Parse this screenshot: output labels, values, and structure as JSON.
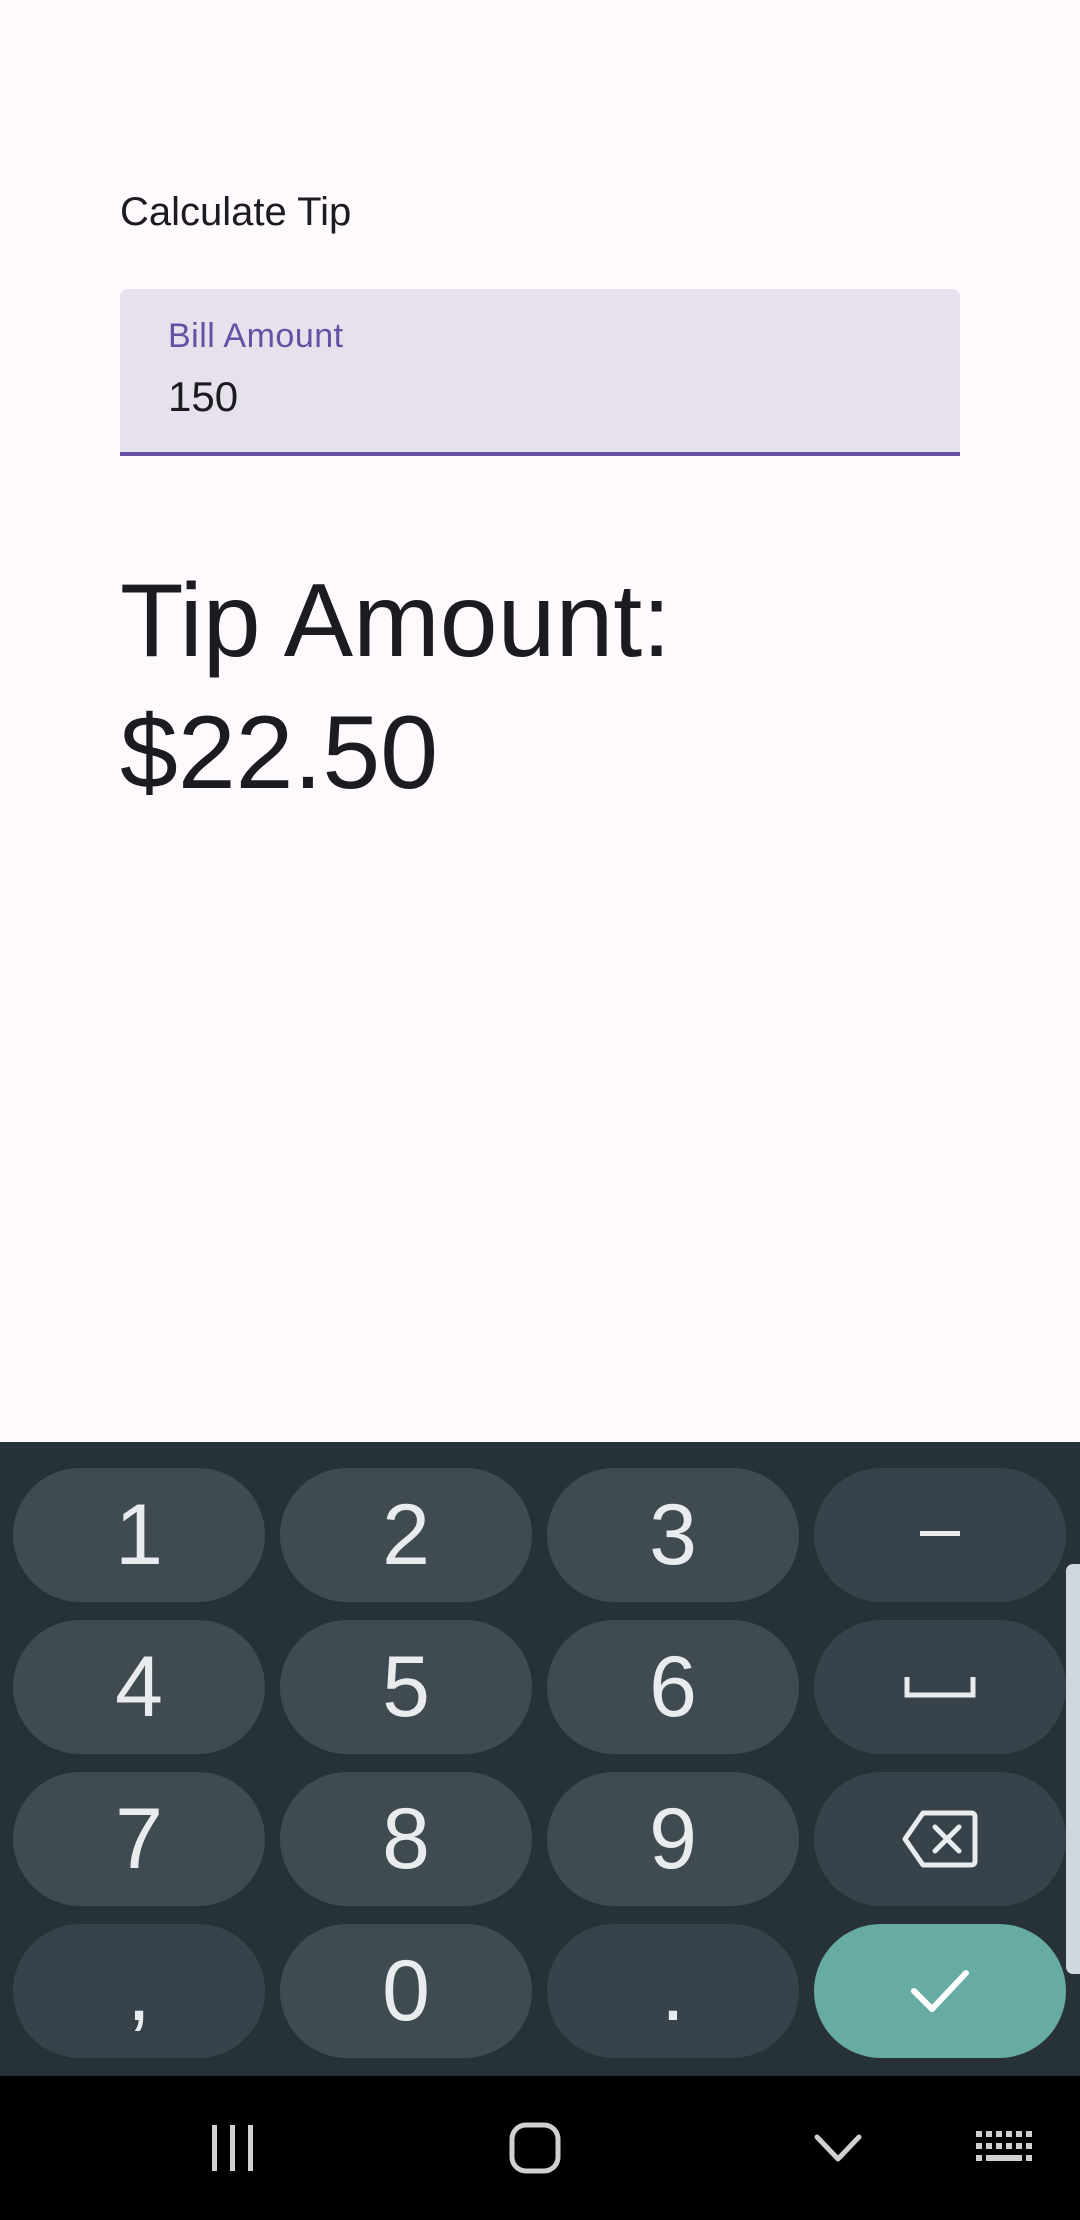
{
  "app": {
    "title": "Calculate Tip"
  },
  "bill_field": {
    "label": "Bill Amount",
    "value": "150"
  },
  "result": {
    "text": "Tip Amount: $22.50"
  },
  "keyboard": {
    "keys": [
      "1",
      "2",
      "3",
      "-",
      "4",
      "5",
      "6",
      "space",
      "7",
      "8",
      "9",
      "backspace",
      ",",
      "0",
      ".",
      "done"
    ],
    "labels": {
      "k1": "1",
      "k2": "2",
      "k3": "3",
      "minus": "-",
      "k4": "4",
      "k5": "5",
      "k6": "6",
      "k7": "7",
      "k8": "8",
      "k9": "9",
      "comma": ",",
      "k0": "0",
      "period": "."
    }
  },
  "navigation": {
    "buttons": [
      "recent-apps",
      "home",
      "back",
      "keyboard-switcher"
    ]
  },
  "colors": {
    "accent": "#6750a4",
    "field_background": "#e6e1ec",
    "keyboard_background": "#263238",
    "key_background": "#404a51",
    "done_key": "#67aca3",
    "page_background": "#fdf9fc"
  }
}
